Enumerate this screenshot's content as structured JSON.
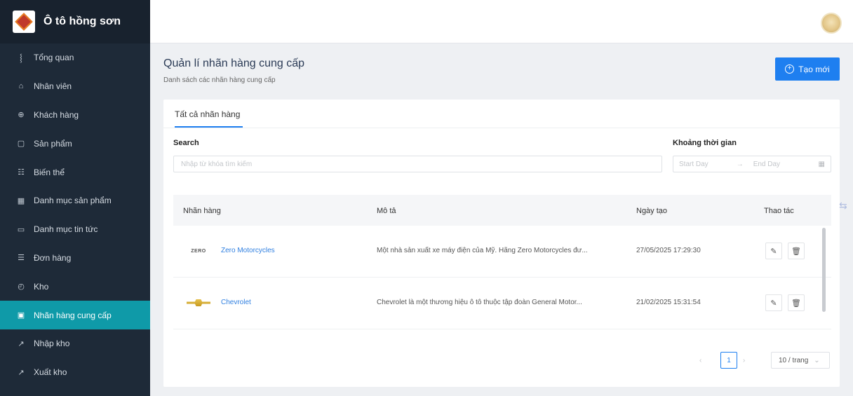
{
  "brand": {
    "name": "Ô tô hồng sơn"
  },
  "sidebar": {
    "items": [
      {
        "label": "Tổng quan",
        "icon": "chart-icon",
        "glyph": "⸾",
        "active": false
      },
      {
        "label": "Nhân viên",
        "icon": "user-icon",
        "glyph": "⌂",
        "active": false
      },
      {
        "label": "Khách hàng",
        "icon": "customer-icon",
        "glyph": "⊕",
        "active": false
      },
      {
        "label": "Sản phẩm",
        "icon": "box-icon",
        "glyph": "▢",
        "active": false
      },
      {
        "label": "Biến thể",
        "icon": "variant-icon",
        "glyph": "☷",
        "active": false
      },
      {
        "label": "Danh mục sản phẩm",
        "icon": "category-icon",
        "glyph": "▦",
        "active": false
      },
      {
        "label": "Danh mục tin tức",
        "icon": "news-icon",
        "glyph": "▭",
        "active": false
      },
      {
        "label": "Đơn hàng",
        "icon": "list-icon",
        "glyph": "☰",
        "active": false
      },
      {
        "label": "Kho",
        "icon": "warehouse-icon",
        "glyph": "◴",
        "active": false
      },
      {
        "label": "Nhãn hàng cung cấp",
        "icon": "brand-icon",
        "glyph": "▣",
        "active": true
      },
      {
        "label": "Nhập kho",
        "icon": "import-icon",
        "glyph": "↗",
        "active": false
      },
      {
        "label": "Xuất kho",
        "icon": "export-icon",
        "glyph": "↗",
        "active": false
      }
    ]
  },
  "header": {
    "title": "Quản lí nhãn hàng cung cấp",
    "subtitle": "Danh sách các nhãn hàng cung cấp",
    "create_label": "Tạo mới"
  },
  "tabs": [
    {
      "label": "Tất cả nhãn hàng"
    }
  ],
  "filters": {
    "search_label": "Search",
    "search_placeholder": "Nhập từ khóa tìm kiếm",
    "range_label": "Khoảng thời gian",
    "start_placeholder": "Start Day",
    "end_placeholder": "End Day"
  },
  "table": {
    "columns": [
      "Nhãn hàng",
      "Mô tả",
      "Ngày tạo",
      "Thao tác"
    ],
    "rows": [
      {
        "name": "Zero Motorcycles",
        "logo": "ZERO",
        "description": "Một nhà sản xuất xe máy điện của Mỹ. Hãng Zero Motorcycles đư...",
        "created": "27/05/2025 17:29:30"
      },
      {
        "name": "Chevrolet",
        "logo": "",
        "description": "Chevrolet là một thương hiệu ô tô thuộc tập đoàn General Motor...",
        "created": "21/02/2025 15:31:54"
      }
    ]
  },
  "pagination": {
    "current": "1",
    "page_size": "10 / trang"
  },
  "colors": {
    "sidebar": "#1e2a38",
    "active": "#0f9aa8",
    "primary": "#1e7ff0"
  }
}
